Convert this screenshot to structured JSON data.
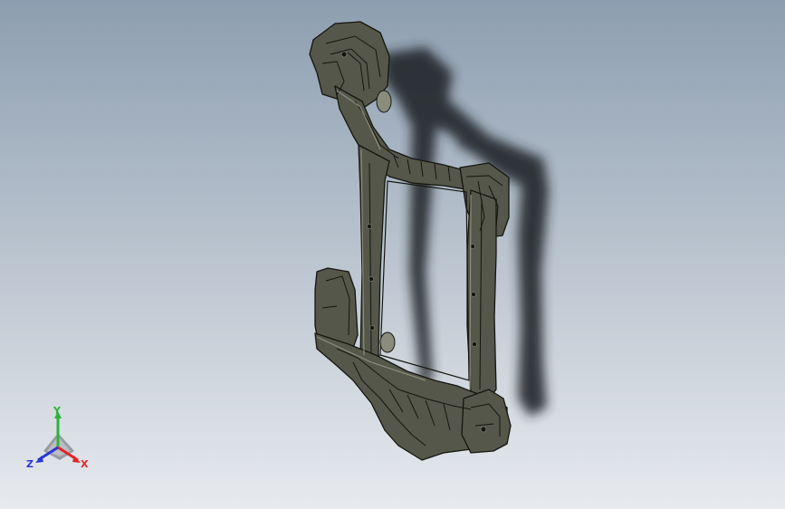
{
  "viewport": {
    "background_top": "#8d9eb0",
    "background_bottom": "#e7eaee"
  },
  "model": {
    "body_color": "#55574a",
    "edge_color": "#15160f",
    "highlight_color": "#8a8c7c",
    "shadow_color": "#23252b"
  },
  "triad": {
    "x_label": "X",
    "y_label": "Y",
    "z_label": "Z",
    "x_color": "#e0262a",
    "y_color": "#2cb33a",
    "z_color": "#2a36d8"
  }
}
